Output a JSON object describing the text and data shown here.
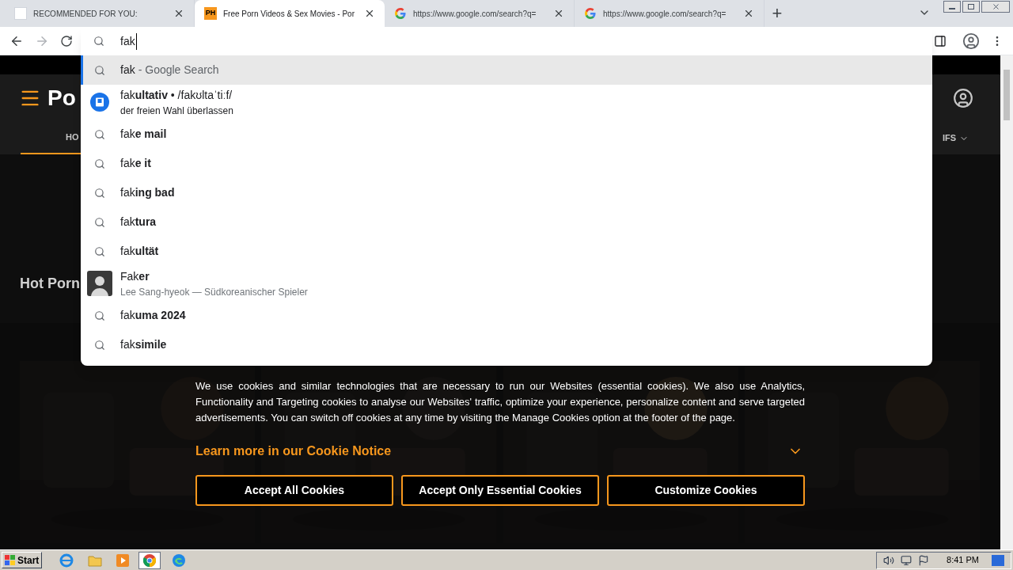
{
  "tabs": [
    {
      "title": "RECOMMENDED FOR YOU:",
      "kind": "blank",
      "selected": false
    },
    {
      "title": "Free Porn Videos & Sex Movies - Por",
      "kind": "badge",
      "badge": "PH",
      "selected": true
    },
    {
      "title": "https://www.google.com/search?q=",
      "kind": "google",
      "selected": false
    },
    {
      "title": "https://www.google.com/search?q=",
      "kind": "google",
      "selected": false
    }
  ],
  "new_tab": "+",
  "address_bar": {
    "value": "fak"
  },
  "suggestions": [
    {
      "kind": "search",
      "text": "fak",
      "hint": "- Google Search",
      "selected": true
    },
    {
      "kind": "dictionary",
      "text": "fak**ultativ** • /fakʊltaˈtiːf/",
      "subtext": "der freien Wahl überlassen",
      "selected": false
    },
    {
      "kind": "search",
      "text": "fak**e mail**",
      "selected": false
    },
    {
      "kind": "search",
      "text": "fak**e it**",
      "selected": false
    },
    {
      "kind": "search",
      "text": "fak**ing bad**",
      "selected": false
    },
    {
      "kind": "search",
      "text": "fak**tura**",
      "selected": false
    },
    {
      "kind": "search",
      "text": "fak**ultät**",
      "selected": false
    },
    {
      "kind": "entity",
      "text": "Fak**er**",
      "subtext": "Lee Sang-hyeok — Südkoreanischer Spieler",
      "selected": false
    },
    {
      "kind": "search",
      "text": "fak**uma 2024**",
      "selected": false
    },
    {
      "kind": "search",
      "text": "fak**simile**",
      "selected": false
    }
  ],
  "site": {
    "logo": "Po",
    "nav": [
      {
        "label": "HO",
        "selected": true
      },
      {
        "label": "IFS",
        "selected": false,
        "caret": true
      }
    ],
    "heading": "Hot Porn"
  },
  "cookie_banner": {
    "text": "We use cookies and similar technologies that are necessary to run our Websites (essential cookies). We also use Analytics, Functionality and Targeting cookies to analyse our Websites' traffic, optimize your experience, personalize content and serve targeted advertisements. You can switch off cookies at any time by visiting the Manage Cookies option at the footer of the page.",
    "link": "Learn more in our Cookie Notice",
    "buttons": [
      "Accept All Cookies",
      "Accept Only Essential Cookies",
      "Customize Cookies"
    ]
  },
  "taskbar": {
    "start": "Start",
    "clock": "8:41 PM"
  }
}
